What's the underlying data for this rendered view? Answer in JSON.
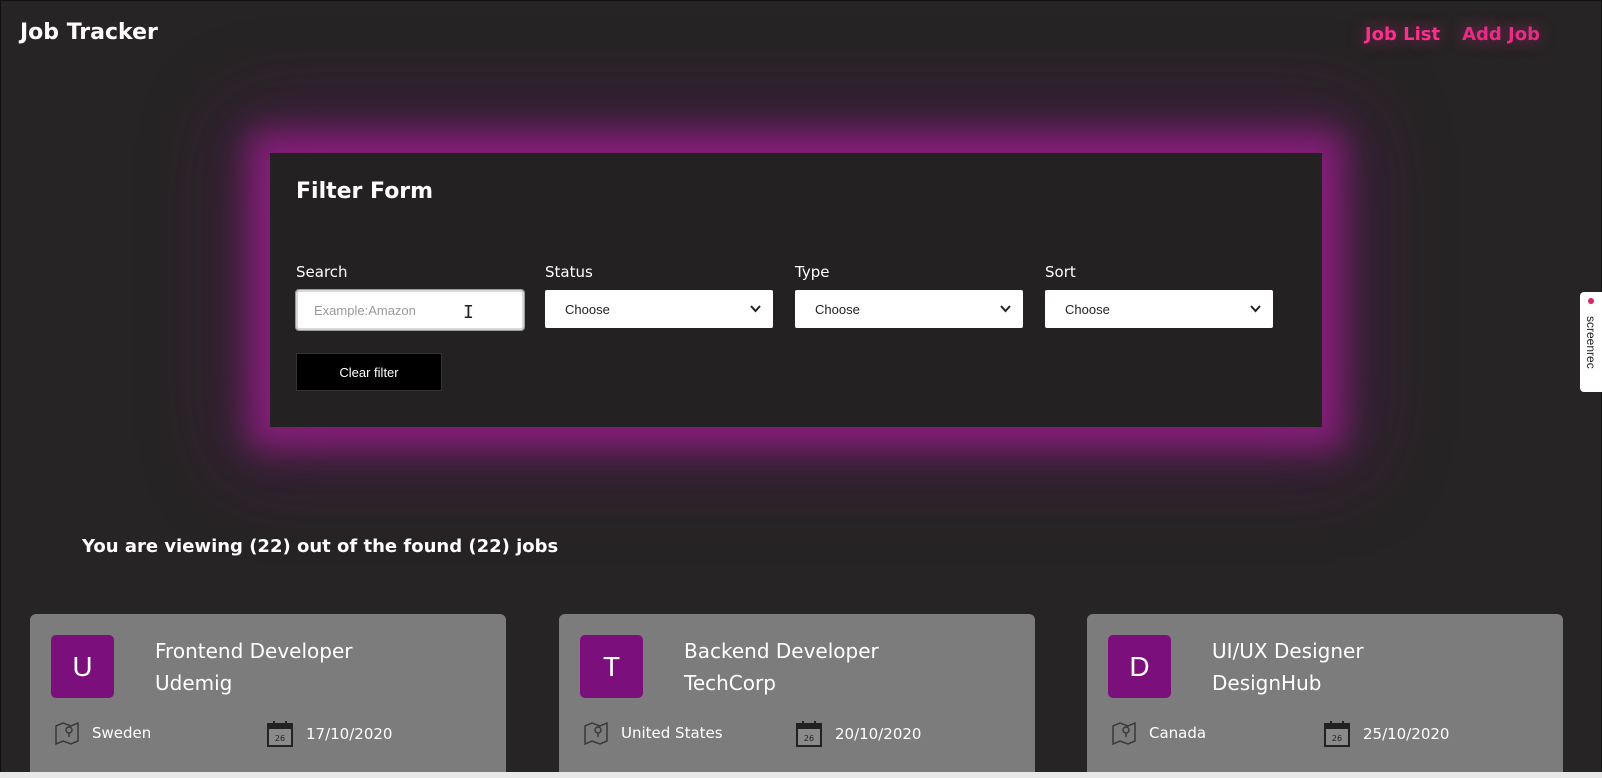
{
  "header": {
    "brand": "Job Tracker",
    "nav": [
      {
        "label": "Job List",
        "active": true
      },
      {
        "label": "Add Job",
        "active": false
      }
    ]
  },
  "filter": {
    "title": "Filter Form",
    "search": {
      "label": "Search",
      "placeholder": "Example:Amazon",
      "value": ""
    },
    "status": {
      "label": "Status",
      "selected": "Choose"
    },
    "type": {
      "label": "Type",
      "selected": "Choose"
    },
    "sort": {
      "label": "Sort",
      "selected": "Choose"
    },
    "clear_label": "Clear filter"
  },
  "summary": "You are viewing (22) out of the found (22) jobs",
  "jobs": [
    {
      "initial": "U",
      "title": "Frontend Developer",
      "company": "Udemig",
      "location": "Sweden",
      "date": "17/10/2020"
    },
    {
      "initial": "T",
      "title": "Backend Developer",
      "company": "TechCorp",
      "location": "United States",
      "date": "20/10/2020"
    },
    {
      "initial": "D",
      "title": "UI/UX Designer",
      "company": "DesignHub",
      "location": "Canada",
      "date": "25/10/2020"
    }
  ],
  "calendar_day": "26",
  "recorder": {
    "label": "screenrec"
  },
  "colors": {
    "background": "#262424",
    "accent": "#ff2f8e",
    "glow": "#be1eaa",
    "avatar": "#7b0f7b",
    "card": "#7c7c7c"
  },
  "icons": {
    "location": "map-pin-icon",
    "date": "calendar-icon",
    "dropdown": "chevron-down-icon",
    "cursor": "text-cursor-icon"
  }
}
